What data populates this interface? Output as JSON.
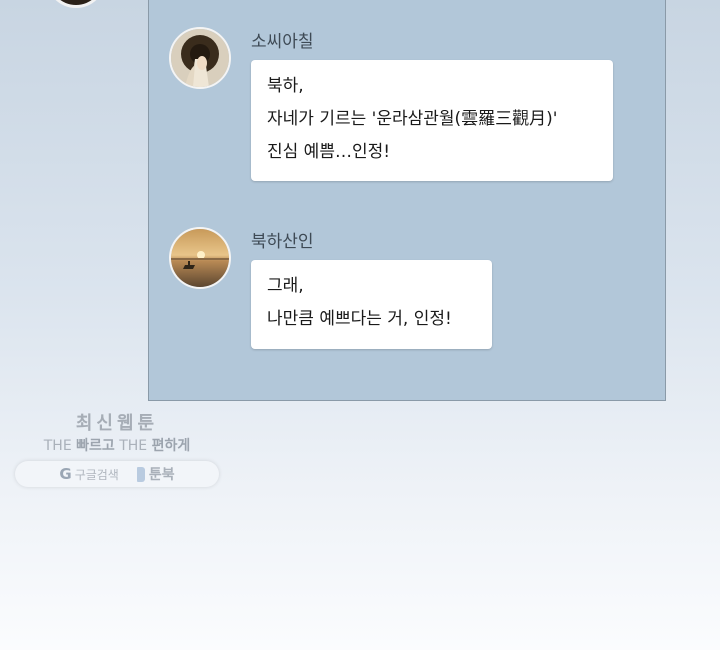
{
  "chat": {
    "messages": [
      {
        "sender": "소씨아칠",
        "lines": [
          "북하,",
          "자네가 기르는 '운라삼관월(雲羅三觀月)'",
          "진심 예쁨…인정!"
        ]
      },
      {
        "sender": "북하산인",
        "lines": [
          "그래,",
          "나만큼 예쁘다는 거, 인정!"
        ]
      }
    ]
  },
  "watermark": {
    "title": "최신웹툰",
    "tag_the1": "THE",
    "tag_word1": "빠르고",
    "tag_the2": "THE",
    "tag_word2": "편하게",
    "google_letter": "G",
    "google_search": "구글검색",
    "toonbook": "툰북"
  }
}
